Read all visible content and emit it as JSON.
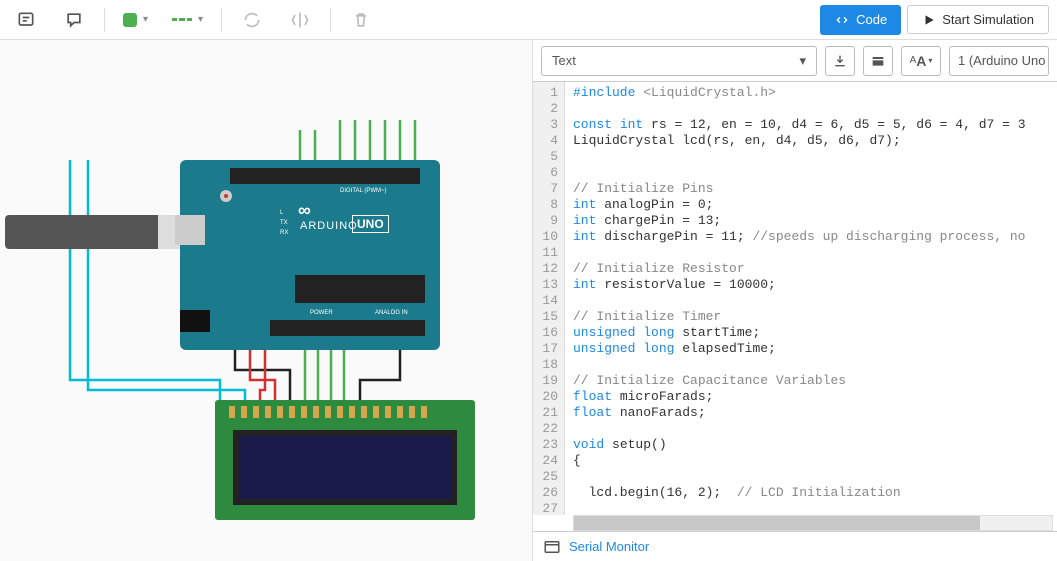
{
  "toolbar": {
    "code_label": "Code",
    "sim_label": "Start Simulation"
  },
  "code_panel": {
    "mode": "Text",
    "board": "1 (Arduino Uno",
    "serial_label": "Serial Monitor"
  },
  "editor": {
    "lines": [
      {
        "n": 1,
        "html": "<span class='pp'>#include</span> <span class='ang'>&lt;LiquidCrystal.h&gt;</span>"
      },
      {
        "n": 2,
        "html": ""
      },
      {
        "n": 3,
        "html": "<span class='kw'>const</span> <span class='type'>int</span> rs = 12, en = 10, d4 = 6, d5 = 5, d6 = 4, d7 = 3"
      },
      {
        "n": 4,
        "html": "LiquidCrystal lcd(rs, en, d4, d5, d6, d7);"
      },
      {
        "n": 5,
        "html": ""
      },
      {
        "n": 6,
        "html": ""
      },
      {
        "n": 7,
        "html": "<span class='cmt'>// Initialize Pins</span>"
      },
      {
        "n": 8,
        "html": "<span class='type'>int</span> analogPin = 0;"
      },
      {
        "n": 9,
        "html": "<span class='type'>int</span> chargePin = 13;"
      },
      {
        "n": 10,
        "html": "<span class='type'>int</span> dischargePin = 11; <span class='cmt'>//speeds up discharging process, no</span>"
      },
      {
        "n": 11,
        "html": ""
      },
      {
        "n": 12,
        "html": "<span class='cmt'>// Initialize Resistor</span>"
      },
      {
        "n": 13,
        "html": "<span class='type'>int</span> resistorValue = 10000;"
      },
      {
        "n": 14,
        "html": ""
      },
      {
        "n": 15,
        "html": "<span class='cmt'>// Initialize Timer</span>"
      },
      {
        "n": 16,
        "html": "<span class='type'>unsigned</span> <span class='type'>long</span> startTime;"
      },
      {
        "n": 17,
        "html": "<span class='type'>unsigned</span> <span class='type'>long</span> elapsedTime;"
      },
      {
        "n": 18,
        "html": ""
      },
      {
        "n": 19,
        "html": "<span class='cmt'>// Initialize Capacitance Variables</span>"
      },
      {
        "n": 20,
        "html": "<span class='type'>float</span> microFarads;"
      },
      {
        "n": 21,
        "html": "<span class='type'>float</span> nanoFarads;"
      },
      {
        "n": 22,
        "html": ""
      },
      {
        "n": 23,
        "html": "<span class='type'>void</span> setup()"
      },
      {
        "n": 24,
        "html": "{"
      },
      {
        "n": 25,
        "html": ""
      },
      {
        "n": 26,
        "html": "  lcd.begin(16, 2);  <span class='cmt'>// LCD Initialization</span>"
      },
      {
        "n": 27,
        "html": ""
      }
    ]
  },
  "schematic": {
    "arduino_text": "ARDUINO",
    "uno_text": "UNO",
    "digital_label": "DIGITAL (PWM~)",
    "power_label": "POWER",
    "analog_label": "ANALOG IN",
    "tx_label": "TX",
    "rx_label": "RX",
    "l_label": "L"
  }
}
